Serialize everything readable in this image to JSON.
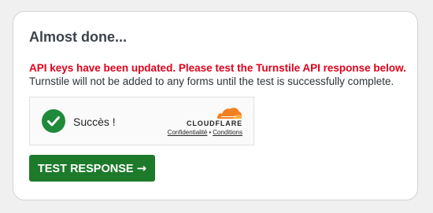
{
  "card": {
    "title": "Almost done...",
    "alert": "API keys have been updated. Please test the Turnstile API response below.",
    "description": "Turnstile will not be added to any forms until the test is successfully complete."
  },
  "widget": {
    "status_text": "Succès !",
    "status_icon": "check-circle-icon",
    "brand": "CLOUDFLARE",
    "brand_logo": "cloudflare-cloud-icon",
    "privacy_link": "Confidentialité",
    "separator": "•",
    "terms_link": "Conditions"
  },
  "button": {
    "label": "TEST RESPONSE",
    "arrow": "→",
    "arrow_icon": "arrow-right-icon"
  },
  "colors": {
    "page_background": "#f0f0f1",
    "card_background": "#ffffff",
    "alert_red": "#e2001a",
    "success_green": "#1e8a3a",
    "button_green": "#1d7a2b",
    "cloudflare_orange": "#f38020",
    "cloudflare_light_orange": "#faae40"
  }
}
